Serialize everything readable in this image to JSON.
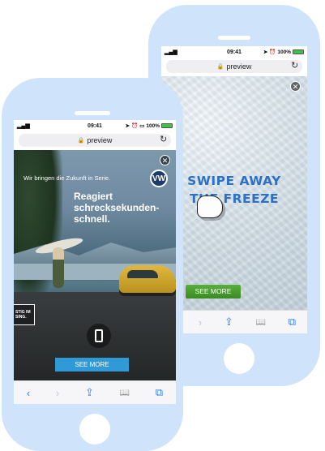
{
  "status_bar": {
    "time": "09:41",
    "battery": "100%"
  },
  "browser": {
    "url": "preview"
  },
  "back_ad": {
    "headline_line1": "SWIPE AWAY",
    "headline_line2": "THE FREEZE",
    "cta": "SEE MORE"
  },
  "front_ad": {
    "tagline": "Wir bringen die Zukunft in Serie.",
    "headline": "Reagiert schrecksekunden-schnell.",
    "box_text": "STIG IM SING.",
    "logo": "VW",
    "cta": "SEE MORE"
  },
  "toolbar": {
    "back_icon": "‹",
    "forward_icon": "›",
    "share_icon": "⇪",
    "bookmarks_icon": "📖",
    "tabs_icon": "⧉"
  },
  "colors": {
    "phone_frame": "#cfe3fb",
    "front_cta": "#2f9ad6",
    "back_cta": "#4a9e2e",
    "swipe_text": "#2c71c4",
    "toolbar_icons": "#2f7cf6"
  }
}
